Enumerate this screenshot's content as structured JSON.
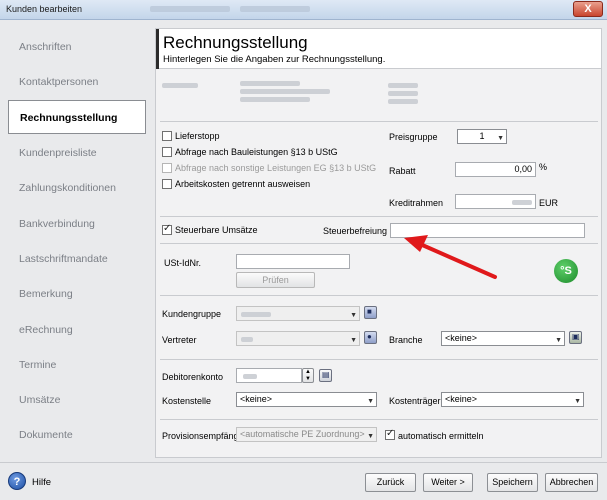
{
  "window": {
    "title": "Kunden bearbeiten",
    "close_label": "X"
  },
  "sidebar": {
    "items": [
      {
        "label": "Anschriften"
      },
      {
        "label": "Kontaktpersonen"
      },
      {
        "label": "Rechnungsstellung"
      },
      {
        "label": "Kundenpreisliste"
      },
      {
        "label": "Zahlungskonditionen"
      },
      {
        "label": "Bankverbindung"
      },
      {
        "label": "Lastschriftmandate"
      },
      {
        "label": "Bemerkung"
      },
      {
        "label": "eRechnung"
      },
      {
        "label": "Termine"
      },
      {
        "label": "Umsätze"
      },
      {
        "label": "Dokumente"
      }
    ],
    "active_index": 2
  },
  "header": {
    "title": "Rechnungsstellung",
    "subtitle": "Hinterlegen Sie die Angaben zur Rechnungsstellung."
  },
  "form": {
    "lieferstopp_label": "Lieferstopp",
    "bauleistungen_label": "Abfrage nach Bauleistungen §13 b UStG",
    "sonstige_label": "Abfrage nach sonstige Leistungen EG §13 b UStG",
    "arbeitskosten_label": "Arbeitskosten getrennt ausweisen",
    "preisgruppe_label": "Preisgruppe",
    "preisgruppe_value": "1",
    "rabatt_label": "Rabatt",
    "rabatt_value": "0,00",
    "rabatt_unit": "%",
    "kreditrahmen_label": "Kreditrahmen",
    "kreditrahmen_unit": "EUR",
    "steuerbare_label": "Steuerbare Umsätze",
    "steuerbefreiung_label": "Steuerbefreiung",
    "ustid_label": "USt-IdNr.",
    "pruefen_label": "Prüfen",
    "kundengruppe_label": "Kundengruppe",
    "vertreter_label": "Vertreter",
    "branche_label": "Branche",
    "branche_value": "<keine>",
    "debitorenkonto_label": "Debitorenkonto",
    "kostenstelle_label": "Kostenstelle",
    "kostenstelle_value": "<keine>",
    "kostentraeger_label": "Kostenträger",
    "kostentraeger_value": "<keine>",
    "provision_label": "Provisionsempfänger",
    "provision_value": "<automatische PE Zuordnung>",
    "auto_label": "automatisch ermitteln"
  },
  "footer": {
    "help_label": "Hilfe",
    "back_label": "Zurück",
    "next_label": "Weiter >",
    "save_label": "Speichern",
    "cancel_label": "Abbrechen"
  },
  "colors": {
    "annotation_arrow": "#e0191b",
    "green_badge": "#2aa83a"
  },
  "icons": {
    "help": "help-icon",
    "green_badge": "s-badge-icon",
    "lookup": "lookup-icon",
    "calendar": "calendar-icon"
  }
}
